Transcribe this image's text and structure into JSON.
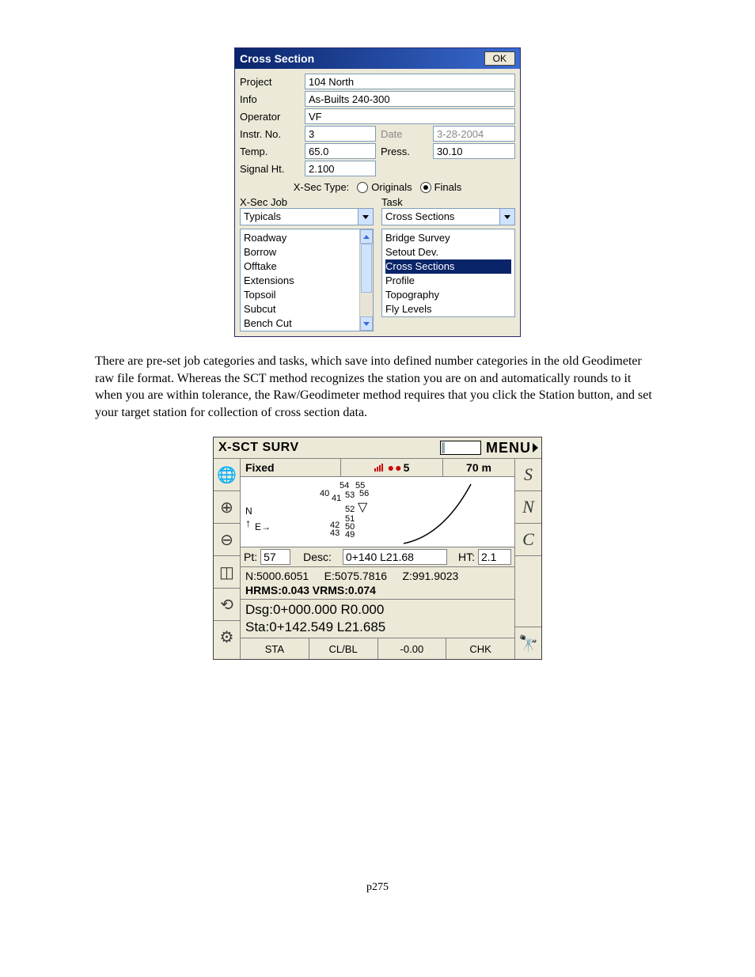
{
  "dialog1": {
    "title": "Cross Section",
    "ok": "OK",
    "labels": {
      "project": "Project",
      "info": "Info",
      "operator": "Operator",
      "instr_no": "Instr. No.",
      "date": "Date",
      "temp": "Temp.",
      "press": "Press.",
      "signal_ht": "Signal Ht.",
      "xsec_type": "X-Sec Type:",
      "originals": "Originals",
      "finals": "Finals",
      "xsec_job": "X-Sec Job",
      "task": "Task"
    },
    "values": {
      "project": "104 North",
      "info": "As-Builts 240-300",
      "operator": "VF",
      "instr_no": "3",
      "date": "3-28-2004",
      "temp": "65.0",
      "press": "30.10",
      "signal_ht": "2.100"
    },
    "xsec_job_selected": "Typicals",
    "task_selected": "Cross Sections",
    "job_list": [
      "Roadway",
      "Borrow",
      "Offtake",
      "Extensions",
      "Topsoil",
      "Subcut",
      "Bench Cut"
    ],
    "task_list": [
      "Bridge Survey",
      "Setout Dev.",
      "Cross Sections",
      "Profile",
      "Topography",
      "Fly Levels"
    ],
    "task_list_selected_index": 2
  },
  "prose": "There are pre-set job categories and tasks, which save into defined number categories in the old Geodimeter raw file format.  Whereas the SCT method recognizes the station you are on and automatically rounds to it when you are within tolerance, the Raw/Geodimeter method requires that you click the Station button, and set your target station for collection of cross section data.",
  "dialog2": {
    "title": "X-SCT SURV",
    "menu": "MENU",
    "status": {
      "fixed": "Fixed",
      "sat": "5",
      "range": "70 m"
    },
    "map_points": [
      "54",
      "55",
      "40",
      "41",
      "53",
      "56",
      "52",
      "51",
      "42",
      "43",
      "50",
      "49"
    ],
    "axes": {
      "n": "N",
      "e": "E"
    },
    "pt_label": "Pt:",
    "pt_value": "57",
    "desc_label": "Desc:",
    "desc_value": "0+140 L21.68",
    "ht_label": "HT:",
    "ht_value": "2.1",
    "coords": {
      "n": "N:5000.6051",
      "e": "E:5075.7816",
      "z": "Z:991.9023",
      "hrms": "HRMS:0.043 VRMS:0.074"
    },
    "dsg": "Dsg:0+000.000 R0.000",
    "sta": "Sta:0+142.549 L21.685",
    "buttons": [
      "STA",
      "CL/BL",
      "-0.00",
      "CHK"
    ],
    "side_right": [
      "S",
      "N",
      "C"
    ]
  },
  "page_number": "p275"
}
